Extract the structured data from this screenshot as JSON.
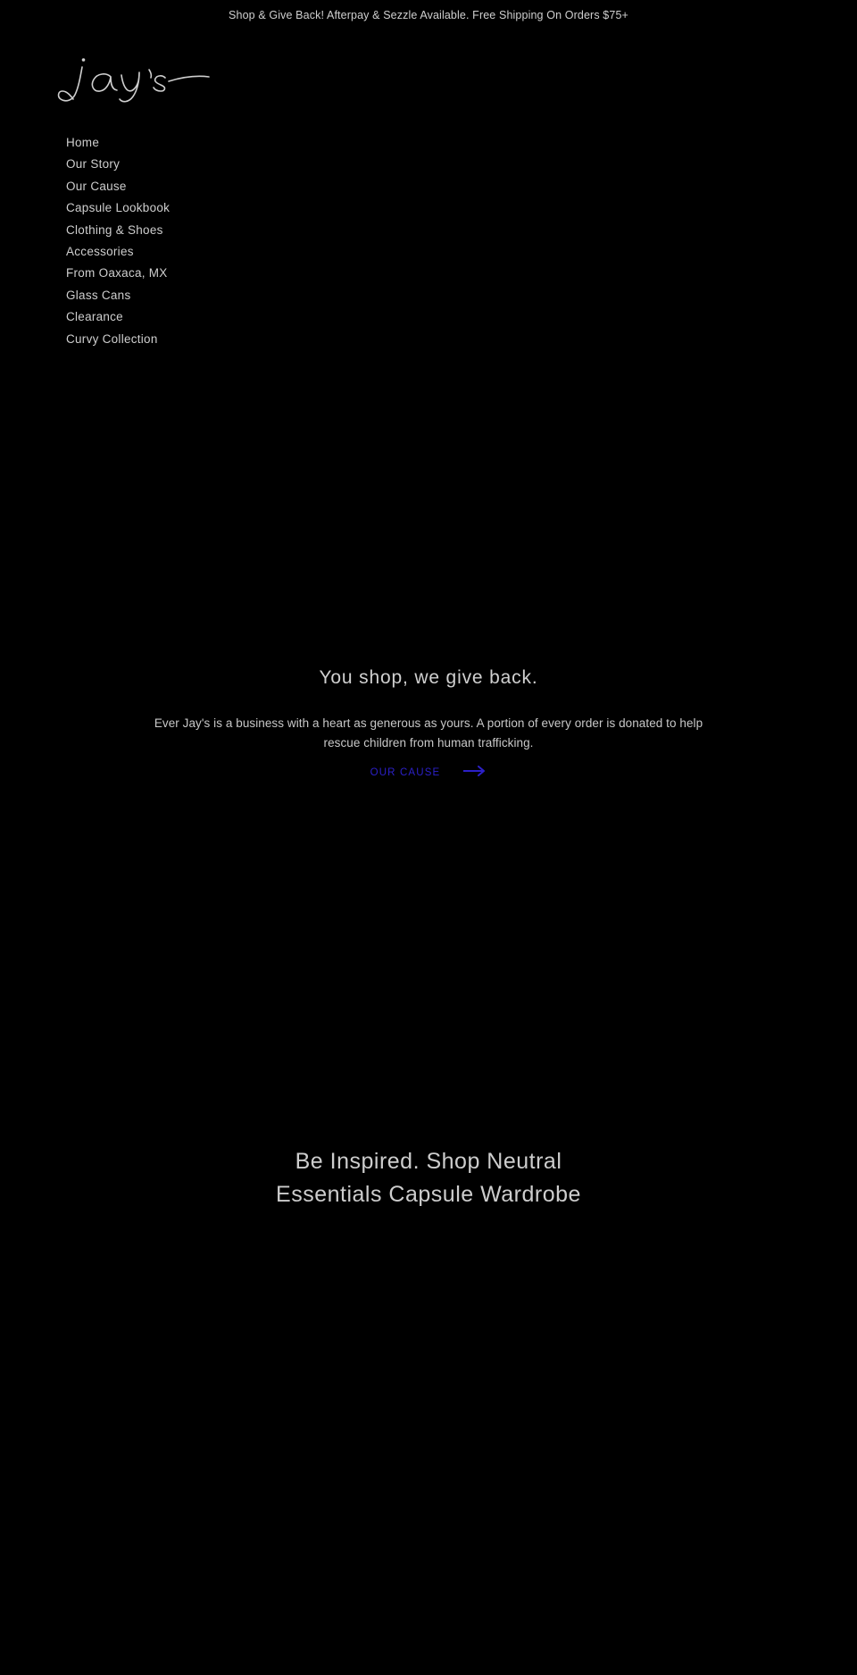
{
  "announcement": {
    "text": "Shop & Give Back! Afterpay & Sezzle Available. Free Shipping On Orders $75+"
  },
  "header": {
    "logo_text": "jay's",
    "logo_icon": "script-wordmark-logo"
  },
  "nav": {
    "items": [
      {
        "label": "Home"
      },
      {
        "label": "Our Story"
      },
      {
        "label": "Our Cause"
      },
      {
        "label": "Capsule Lookbook"
      },
      {
        "label": "Clothing & Shoes"
      },
      {
        "label": "Accessories"
      },
      {
        "label": "From Oaxaca, MX"
      },
      {
        "label": "Glass Cans"
      },
      {
        "label": "Clearance"
      },
      {
        "label": "Curvy Collection"
      }
    ]
  },
  "giveback": {
    "title": "You shop, we give back.",
    "body": "Ever Jay's is a business with a heart as generous as yours. A portion of every order is donated to help rescue children from human trafficking.",
    "link_label": "Our Cause",
    "arrow_icon": "arrow-right-icon",
    "link_color": "#2c20c8"
  },
  "capsule": {
    "heading_line_1": "Be Inspired. Shop Neutral",
    "heading_line_2": "Essentials Capsule Wardrobe"
  },
  "theme": {
    "background": "#000000",
    "text": "#cecece",
    "accent": "#2c20c8"
  }
}
